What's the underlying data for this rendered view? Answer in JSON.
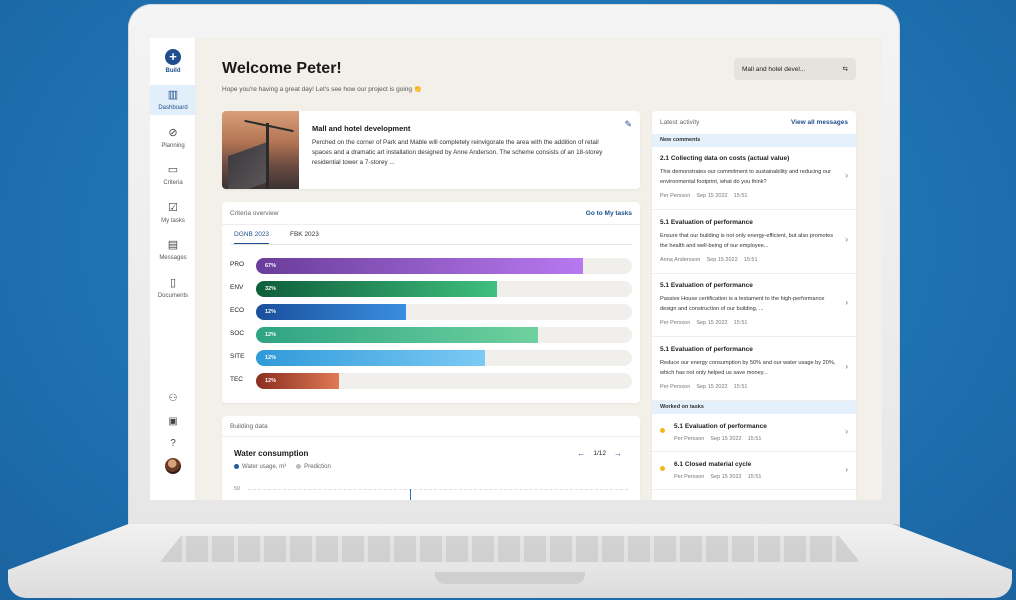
{
  "sidebar": {
    "build": {
      "icon": "plus-icon",
      "label": "Build"
    },
    "items": [
      {
        "name": "dashboard",
        "label": "Dashboard",
        "icon": "bar-chart-icon",
        "active": true
      },
      {
        "name": "planning",
        "label": "Planning",
        "icon": "compass-icon"
      },
      {
        "name": "criteria",
        "label": "Criteria",
        "icon": "briefcase-icon"
      },
      {
        "name": "my-tasks",
        "label": "My tasks",
        "icon": "checkbox-icon"
      },
      {
        "name": "messages",
        "label": "Messages",
        "icon": "chat-icon"
      },
      {
        "name": "documents",
        "label": "Documents",
        "icon": "document-icon"
      }
    ],
    "bottom_icons": [
      "users-icon",
      "report-search-icon",
      "help-icon",
      "avatar"
    ]
  },
  "header": {
    "title": "Welcome Peter!",
    "subtitle": "Hope you're having a great day! Let's see how our project is going 👏",
    "project_select": "Mall and hotel devel...",
    "project_select_icon": "swap-icon"
  },
  "project": {
    "title": "Mall and hotel development",
    "description": "Perched on the corner of Park and Mable will completely reinvigorate the area with the addition of retail spaces and a dramatic art installation designed by Anne Anderson. The scheme consists of an 18-storey residential tower a 7-storey ..."
  },
  "criteria": {
    "heading": "Criteria overview",
    "link": "Go to My tasks",
    "tabs": [
      {
        "label": "DGNB 2023",
        "active": true
      },
      {
        "label": "FBK 2023",
        "active": false
      }
    ],
    "rows": [
      {
        "label": "PRO",
        "pct_label": "67%",
        "value": 0.87,
        "color_from": "#6a3d9a",
        "color_to": "#b879f0"
      },
      {
        "label": "ENV",
        "pct_label": "32%",
        "value": 0.64,
        "color_from": "#0e5e3a",
        "color_to": "#3fbf7f"
      },
      {
        "label": "ECO",
        "pct_label": "12%",
        "value": 0.4,
        "color_from": "#1a4f9c",
        "color_to": "#3a8ee0"
      },
      {
        "label": "SOC",
        "pct_label": "12%",
        "value": 0.75,
        "color_from": "#2ea383",
        "color_to": "#6fd19e"
      },
      {
        "label": "SITE",
        "pct_label": "12%",
        "value": 0.61,
        "color_from": "#2f9ad9",
        "color_to": "#7ccaf4"
      },
      {
        "label": "TEC",
        "pct_label": "12%",
        "value": 0.22,
        "color_from": "#8a2e1e",
        "color_to": "#e07a56"
      }
    ]
  },
  "building": {
    "heading": "Building data",
    "chart_title": "Water consumption",
    "legend": [
      {
        "label": "Water usage, m³",
        "color": "#1e5e9c"
      },
      {
        "label": "Prediction",
        "color": "#bdbdbd"
      }
    ],
    "pager": "1/12",
    "ytick": "50"
  },
  "activity": {
    "heading": "Latest activity",
    "link": "View all messages",
    "comments_band": "New comments",
    "comments": [
      {
        "title": "2.1 Collecting data on costs (actual value)",
        "body": "This demonstrates our commitment to sustainability and reducing our environmental footprint, what do you think?",
        "meta": "Per Persson    Sep 15 2022    15:51"
      },
      {
        "title": "5.1 Evaluation of performance",
        "body": "Ensure that our building is not only energy-efficient, but also promotes the health and well-being of our employee...",
        "meta": "Anna Andersson    Sep 15 2022    15:51"
      },
      {
        "title": "5.1 Evaluation of performance",
        "body": "Passive House certification is a testament to the high-performance design and construction of our building, ...",
        "meta": "Per Persson    Sep 15 2022    15:51"
      },
      {
        "title": "5.1 Evaluation of performance",
        "body": "Reduce our energy consumption by 50% and our water usage by 20%, which has not only helped us save money...",
        "meta": "Per Persson    Sep 15 2022    15:51"
      }
    ],
    "tasks_band": "Worked on tasks",
    "tasks": [
      {
        "title": "5.1 Evaluation of performance",
        "meta": "Per Persson    Sep 15 2022    15:51"
      },
      {
        "title": "6.1 Closed material cycle",
        "meta": "Per Persson    Sep 15 2022    15:51"
      }
    ]
  }
}
